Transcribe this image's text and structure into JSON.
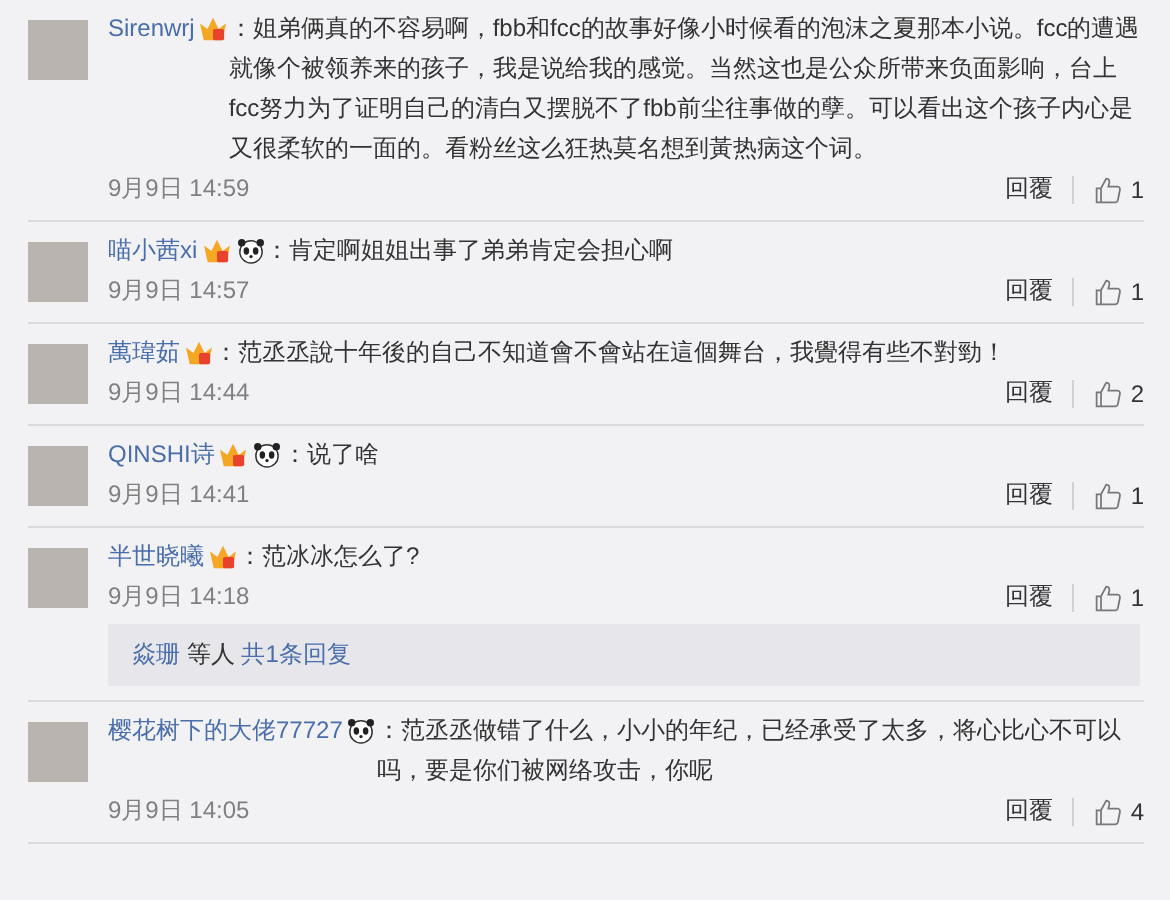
{
  "comments": [
    {
      "author": "Sirenwrj",
      "badges": [
        {
          "kind": "vip"
        }
      ],
      "text": "：姐弟俩真的不容易啊，fbb和fcc的故事好像小时候看的泡沫之夏那本小说。fcc的遭遇就像个被领养来的孩子，我是说给我的感觉。当然这也是公众所带来负面影响，台上fcc努力为了证明自己的清白又摆脱不了fbb前尘往事做的孽。可以看出这个孩子内心是又很柔软的一面的。看粉丝这么狂热莫名想到黃热病这个词。",
      "time": "9月9日 14:59",
      "reply": "回覆",
      "likes": "1"
    },
    {
      "author": "喵小茜xi",
      "badges": [
        {
          "kind": "vip"
        },
        {
          "kind": "panda"
        }
      ],
      "text": "：肯定啊姐姐出事了弟弟肯定会担心啊",
      "time": "9月9日 14:57",
      "reply": "回覆",
      "likes": "1"
    },
    {
      "author": "萬瑋茹",
      "badges": [
        {
          "kind": "vip"
        }
      ],
      "text": "：范丞丞說十年後的自己不知道會不會站在這個舞台，我覺得有些不對勁！",
      "time": "9月9日 14:44",
      "reply": "回覆",
      "likes": "2"
    },
    {
      "author": "QINSHI诗",
      "badges": [
        {
          "kind": "vip"
        },
        {
          "kind": "panda"
        }
      ],
      "text": "：说了啥",
      "time": "9月9日 14:41",
      "reply": "回覆",
      "likes": "1"
    },
    {
      "author": "半世晓曦",
      "badges": [
        {
          "kind": "vip"
        }
      ],
      "text": "：范冰冰怎么了?",
      "time": "9月9日 14:18",
      "reply": "回覆",
      "likes": "1",
      "replies_summary": {
        "user": "焱珊",
        "middle": "等人",
        "count": "共1条回复"
      }
    },
    {
      "author": "樱花树下的大佬77727",
      "badges": [
        {
          "kind": "panda"
        }
      ],
      "text": "：范丞丞做错了什么，小小的年纪，已经承受了太多，将心比心不可以吗，要是你们被网络攻击，你呢",
      "time": "9月9日 14:05",
      "reply": "回覆",
      "likes": "4"
    }
  ]
}
